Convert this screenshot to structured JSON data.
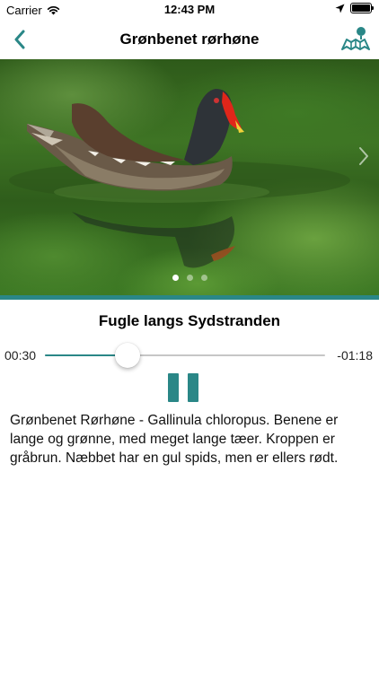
{
  "status_bar": {
    "carrier": "Carrier",
    "time": "12:43 PM"
  },
  "nav": {
    "title": "Grønbenet rørhøne",
    "back_icon": "chevron-left-icon",
    "map_icon": "map-pin-icon"
  },
  "carousel": {
    "image_label": "moorhen-photo",
    "page_count": 3,
    "current_page": 1,
    "next_icon": "chevron-right-icon"
  },
  "player": {
    "track_title": "Fugle langs Sydstranden",
    "elapsed": "00:30",
    "remaining": "-01:18",
    "progress": 0.295,
    "pause_icon": "pause-icon"
  },
  "description": "Grønbenet Rørhøne - Gallinula chloropus. Benene er lange og grønne, med meget lange tæer. Kroppen er gråbrun. Næbbet har en gul spids, men er ellers rødt.",
  "colors": {
    "accent": "#2a8787",
    "track": "#c6c6c6"
  }
}
